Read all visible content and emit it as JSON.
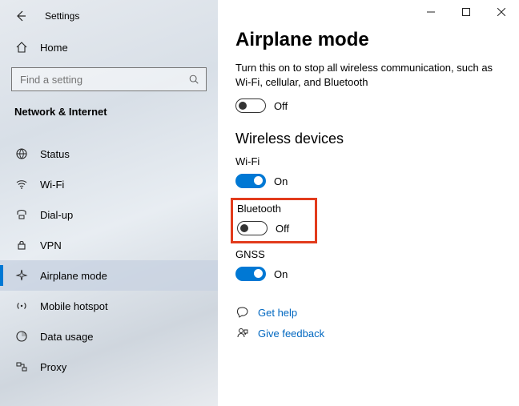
{
  "titlebar": {
    "app_title": "Settings"
  },
  "home_label": "Home",
  "search": {
    "placeholder": "Find a setting"
  },
  "category": "Network & Internet",
  "nav": [
    {
      "label": "Status"
    },
    {
      "label": "Wi-Fi"
    },
    {
      "label": "Dial-up"
    },
    {
      "label": "VPN"
    },
    {
      "label": "Airplane mode"
    },
    {
      "label": "Mobile hotspot"
    },
    {
      "label": "Data usage"
    },
    {
      "label": "Proxy"
    }
  ],
  "page": {
    "title": "Airplane mode",
    "desc": "Turn this on to stop all wireless communication, such as Wi-Fi, cellular, and Bluetooth",
    "airplane_state": "Off",
    "wireless_title": "Wireless devices",
    "devices": {
      "wifi": {
        "name": "Wi-Fi",
        "state": "On"
      },
      "bluetooth": {
        "name": "Bluetooth",
        "state": "Off"
      },
      "gnss": {
        "name": "GNSS",
        "state": "On"
      }
    },
    "links": {
      "help": "Get help",
      "feedback": "Give feedback"
    }
  }
}
